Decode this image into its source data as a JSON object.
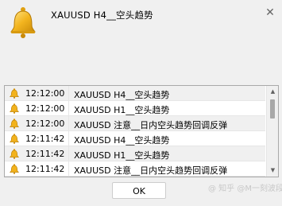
{
  "alert": {
    "header_message": "XAUUSD  H4__空头趋势",
    "icon": "bell-icon",
    "close_symbol": "✕"
  },
  "rows": [
    {
      "time": "12:12:00",
      "message": "XAUUSD  H4__空头趋势"
    },
    {
      "time": "12:12:00",
      "message": "XAUUSD  H1__空头趋势"
    },
    {
      "time": "12:12:00",
      "message": "XAUUSD 注意__日内空头趋势回调反弹"
    },
    {
      "time": "12:11:42",
      "message": "XAUUSD  H4__空头趋势"
    },
    {
      "time": "12:11:42",
      "message": "XAUUSD  H1__空头趋势"
    },
    {
      "time": "12:11:42",
      "message": "XAUUSD 注意__日内空头趋势回调反弹"
    }
  ],
  "buttons": {
    "ok": "OK"
  },
  "watermark": "@ 知乎 @M一刻波段",
  "colors": {
    "bell_gold": "#e8a417",
    "bell_light": "#ffd54a",
    "row_highlight": "#f0f0f0"
  }
}
